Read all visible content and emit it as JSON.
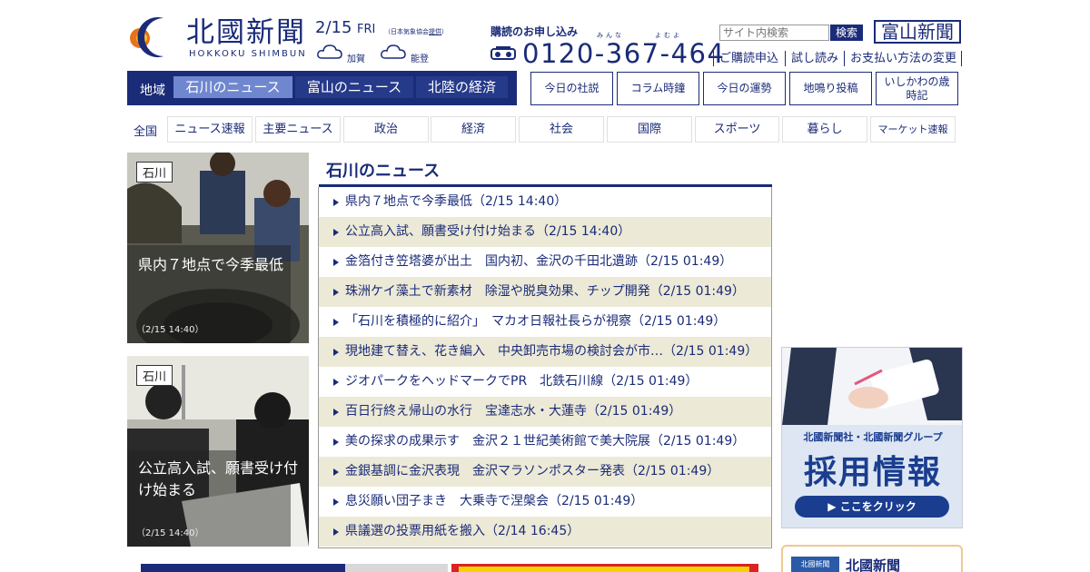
{
  "header": {
    "logo_text": "北國新聞",
    "logo_sub": "HOKKOKU SHIMBUN",
    "date": "2/15",
    "day_of_week": "FRI",
    "weather_note": "（日本気象協会",
    "weather_note_link": "提供",
    "weather_note_end": "）",
    "weather": [
      {
        "area": "加賀",
        "icon": "cloud-icon"
      },
      {
        "area": "能登",
        "icon": "cloud-icon"
      }
    ],
    "subscribe_label": "購読のお申し込み",
    "ruby_1": "みんな",
    "ruby_2": "よむよ",
    "phone": "0120-367-464",
    "search_placeholder": "サイト内検索",
    "search_button": "検索",
    "toyama_logo": "富山新聞",
    "utility_links": [
      "ご購読申込",
      "試し読み",
      "お支払い方法の変更"
    ]
  },
  "nav": {
    "region_label": "地域",
    "tabs": [
      {
        "label": "石川のニュース",
        "active": true
      },
      {
        "label": "富山のニュース",
        "active": false
      },
      {
        "label": "北陸の経済",
        "active": false
      }
    ],
    "features": [
      "今日の社説",
      "コラム時鐘",
      "今日の運勢",
      "地鳴り投稿",
      "いしかわの歳時記"
    ]
  },
  "categories": {
    "all_label": "全国",
    "items": [
      "ニュース速報",
      "主要ニュース",
      "政治",
      "経済",
      "社会",
      "国際",
      "スポーツ",
      "暮らし",
      "マーケット速報"
    ]
  },
  "cards": [
    {
      "tag": "石川",
      "title": "県内７地点で今季最低",
      "time": "（2/15 14:40）"
    },
    {
      "tag": "石川",
      "title": "公立高入試、願書受け付け始まる",
      "time": "（2/15 14:40）"
    }
  ],
  "news": {
    "title": "石川のニュース",
    "items": [
      "県内７地点で今季最低（2/15 14:40）",
      "公立高入試、願書受け付け始まる（2/15 14:40）",
      "金箔付き笠塔婆が出土　国内初、金沢の千田北遺跡（2/15 01:49）",
      "珠洲ケイ藻土で新素材　除湿や脱臭効果、チップ開発（2/15 01:49）",
      "「石川を積極的に紹介」　マカオ日報社長らが視察（2/15 01:49）",
      "現地建て替え、花き編入　中央卸売市場の検討会が市…（2/15 01:49）",
      "ジオパークをヘッドマークでPR　北鉄石川線（2/15 01:49）",
      "百日行終え帰山の水行　宝達志水・大蓮寺（2/15 01:49）",
      "美の探求の成果示す　金沢２１世紀美術館で美大院展（2/15 01:49）",
      "金銀基調に金沢表現　金沢マラソンポスター発表（2/15 01:49）",
      "息災願い団子まき　大乗寺で涅槃会（2/15 01:49）",
      "県議選の投票用紙を搬入（2/14 16:45）"
    ]
  },
  "ad": {
    "company": "北國新聞社・北國新聞グループ",
    "main": "採用情報",
    "button": "▶ ここをクリック"
  },
  "bottom_box": {
    "logo": "北國新聞",
    "name": "北國新聞"
  },
  "colors": {
    "brand": "#1a2b78",
    "active_tab": "#6f87cf",
    "alt_row": "#ece9d6"
  }
}
